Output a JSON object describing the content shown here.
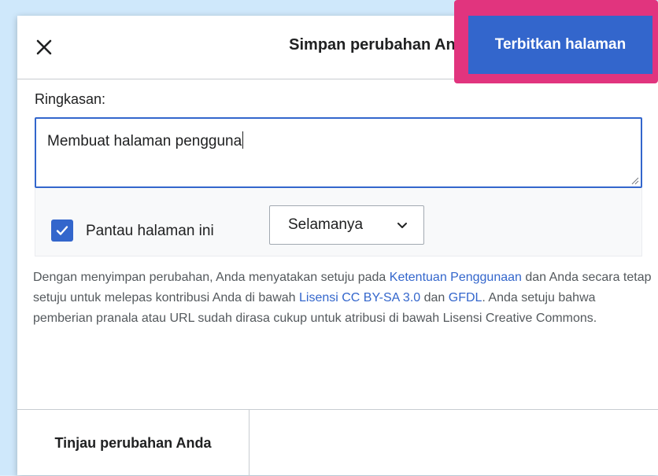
{
  "dialog": {
    "title": "Simpan perubahan Anda",
    "close_icon": "close-icon",
    "publish_label": "Terbitkan halaman"
  },
  "summary": {
    "label": "Ringkasan:",
    "value": "Membuat halaman pengguna"
  },
  "options": {
    "watch_label": "Pantau halaman ini",
    "watch_checked": true,
    "watch_period": "Selamanya",
    "keyboard_icon": "keyboard-icon"
  },
  "license": {
    "text_1": "Dengan menyimpan perubahan, Anda menyatakan setuju pada ",
    "link_terms": "Ketentuan Penggunaan",
    "text_2": " dan Anda secara tetap setuju untuk melepas kontribusi Anda di bawah ",
    "link_cc": "Lisensi CC BY-SA 3.0",
    "text_3": " dan ",
    "link_gfdl": "GFDL",
    "text_4": ". Anda setuju bahwa pemberian pranala atau URL sudah dirasa cukup untuk atribusi di bawah Lisensi Creative Commons."
  },
  "footer": {
    "review_label": "Tinjau perubahan Anda"
  },
  "colors": {
    "accent": "#3366cc",
    "highlight": "#e1347e",
    "background": "#dbeefd"
  }
}
